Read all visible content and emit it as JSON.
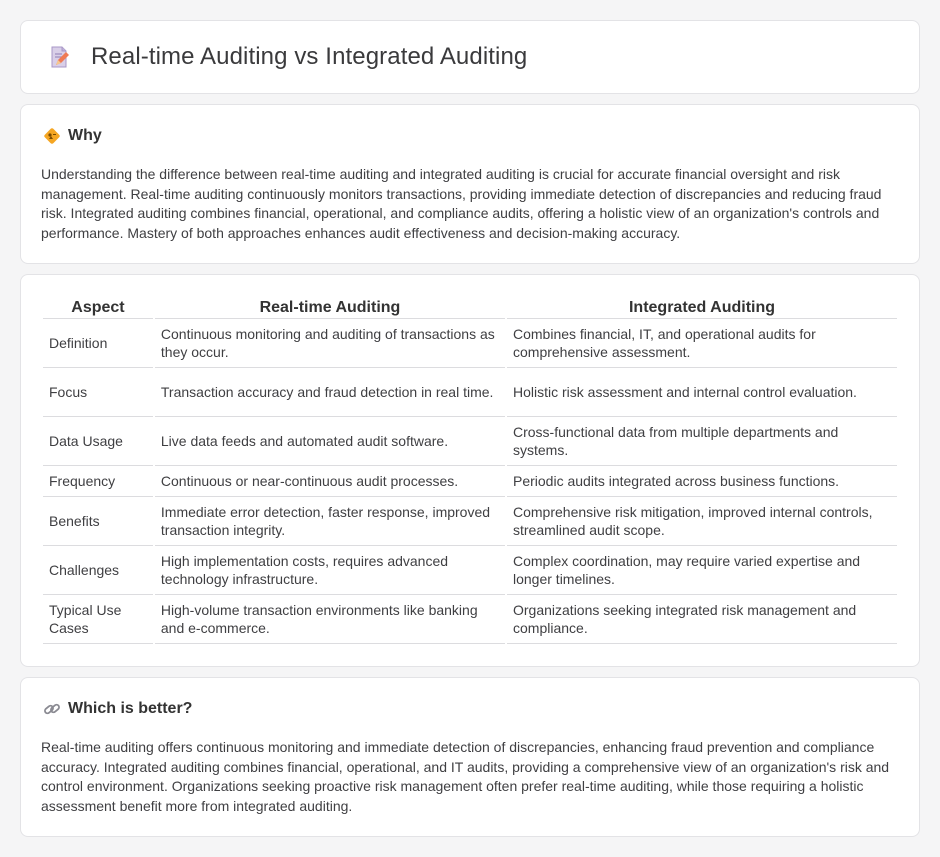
{
  "header": {
    "title": "Real-time Auditing vs Integrated Auditing",
    "icon": "document-pencil-icon"
  },
  "why": {
    "heading": "Why",
    "icon": "diamond-sign-icon",
    "text": "Understanding the difference between real-time auditing and integrated auditing is crucial for accurate financial oversight and risk management. Real-time auditing continuously monitors transactions, providing immediate detection of discrepancies and reducing fraud risk. Integrated auditing combines financial, operational, and compliance audits, offering a holistic view of an organization's controls and performance. Mastery of both approaches enhances audit effectiveness and decision-making accuracy."
  },
  "table": {
    "headers": [
      "Aspect",
      "Real-time Auditing",
      "Integrated Auditing"
    ],
    "rows": [
      [
        "Definition",
        "Continuous monitoring and auditing of transactions as they occur.",
        "Combines financial, IT, and operational audits for comprehensive assessment."
      ],
      [
        "Focus",
        "Transaction accuracy and fraud detection in real time.",
        "Holistic risk assessment and internal control evaluation."
      ],
      [
        "Data Usage",
        "Live data feeds and automated audit software.",
        "Cross-functional data from multiple departments and systems."
      ],
      [
        "Frequency",
        "Continuous or near-continuous audit processes.",
        "Periodic audits integrated across business functions."
      ],
      [
        "Benefits",
        "Immediate error detection, faster response, improved transaction integrity.",
        "Comprehensive risk mitigation, improved internal controls, streamlined audit scope."
      ],
      [
        "Challenges",
        "High implementation costs, requires advanced technology infrastructure.",
        "Complex coordination, may require varied expertise and longer timelines."
      ],
      [
        "Typical Use Cases",
        "High-volume transaction environments like banking and e-commerce.",
        "Organizations seeking integrated risk management and compliance."
      ]
    ]
  },
  "better": {
    "heading": "Which is better?",
    "icon": "link-icon",
    "text": "Real-time auditing offers continuous monitoring and immediate detection of discrepancies, enhancing fraud prevention and compliance accuracy. Integrated auditing combines financial, operational, and IT audits, providing a comprehensive view of an organization's risk and control environment. Organizations seeking proactive risk management often prefer real-time auditing, while those requiring a holistic assessment benefit more from integrated auditing."
  },
  "colors": {
    "background": "#f5f5f6",
    "card": "#ffffff",
    "accent_orange": "#f5a623",
    "icon_pink": "#e96a6a"
  }
}
